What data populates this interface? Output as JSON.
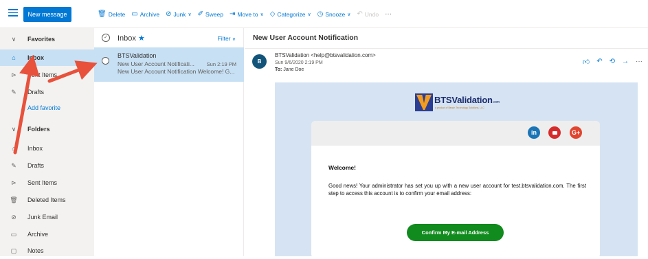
{
  "toolbar": {
    "new_message": "New message",
    "actions": [
      {
        "label": "Delete",
        "icon": "trash-icon"
      },
      {
        "label": "Archive",
        "icon": "archive-icon"
      },
      {
        "label": "Junk",
        "icon": "block-icon"
      },
      {
        "label": "Sweep",
        "icon": "broom-icon"
      },
      {
        "label": "Move to",
        "icon": "move-icon"
      },
      {
        "label": "Categorize",
        "icon": "tag-icon"
      },
      {
        "label": "Snooze",
        "icon": "clock-icon"
      },
      {
        "label": "Undo",
        "icon": "undo-icon"
      }
    ]
  },
  "nav": {
    "favorites_label": "Favorites",
    "favorites": [
      {
        "label": "Inbox",
        "icon": "inbox-icon"
      },
      {
        "label": "Sent Items",
        "icon": "send-icon"
      },
      {
        "label": "Drafts",
        "icon": "pencil-icon"
      }
    ],
    "add_favorite": "Add favorite",
    "folders_label": "Folders",
    "folders": [
      {
        "label": "Inbox",
        "icon": "inbox-icon"
      },
      {
        "label": "Drafts",
        "icon": "pencil-icon"
      },
      {
        "label": "Sent Items",
        "icon": "send-icon"
      },
      {
        "label": "Deleted Items",
        "icon": "trash-icon"
      },
      {
        "label": "Junk Email",
        "icon": "block-icon"
      },
      {
        "label": "Archive",
        "icon": "archive-icon"
      },
      {
        "label": "Notes",
        "icon": "note-icon"
      }
    ]
  },
  "list": {
    "title": "Inbox",
    "filter": "Filter",
    "message": {
      "sender": "BTSValidation",
      "subject": "New User Account Notificati...",
      "time": "Sun 2:19 PM",
      "preview": "New User Account Notification Welcome! G..."
    }
  },
  "reader": {
    "subject": "New User Account Notification",
    "avatar_letter": "B",
    "from": "BTSValidation <help@btsvalidation.com>",
    "date": "Sun 9/6/2020 2:19 PM",
    "to_label": "To:",
    "to": "Jane Doe"
  },
  "email": {
    "logo_text": "BTSValidation",
    "logo_suffix": ".com",
    "logo_tagline": "a product of Beach Technology Solutions, LLC",
    "social": [
      "in",
      "G+"
    ],
    "welcome": "Welcome!",
    "body": "Good news! Your administrator has set you up with a new user account for test.btsvalidation.com. The first step to access this account is to confirm your email address:",
    "button": "Confirm My E-mail Address"
  },
  "colors": {
    "accent": "#0078d4",
    "selected_bg": "#c7e0f4",
    "nav_bg": "#f3f2f1",
    "annotation_arrow": "#e8513b",
    "confirm_button": "#118a1e"
  }
}
